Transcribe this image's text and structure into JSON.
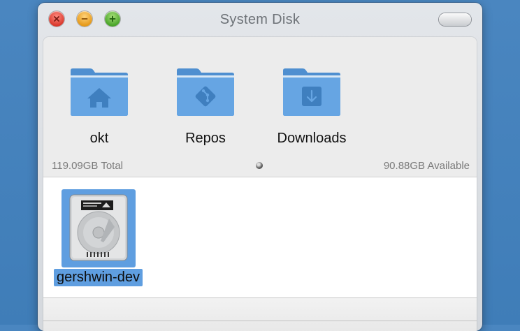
{
  "window": {
    "title": "System Disk"
  },
  "places": [
    {
      "label": "okt",
      "icon": "home-folder-icon"
    },
    {
      "label": "Repos",
      "icon": "git-folder-icon"
    },
    {
      "label": "Downloads",
      "icon": "downloads-folder-icon"
    }
  ],
  "disk_info": {
    "total": "119.09GB Total",
    "available": "90.88GB Available"
  },
  "files": [
    {
      "label": "gershwin-dev",
      "icon": "hard-disk-icon",
      "selected": true
    }
  ],
  "colors": {
    "folder": "#5b9ad8",
    "selection": "#5f9ee0",
    "desktop": "#4a86c0"
  }
}
